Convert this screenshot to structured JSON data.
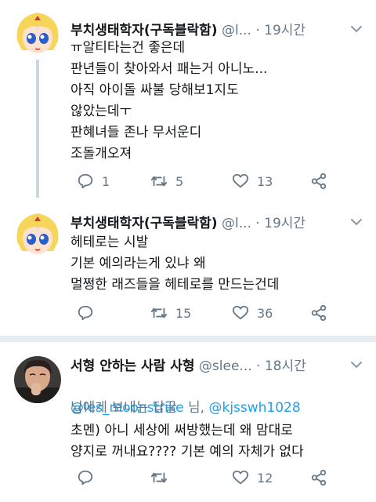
{
  "tweets": [
    {
      "name": "부치생태학자(구독블락함)",
      "handle": "@l...",
      "dot": "·",
      "time": "19시간",
      "text": "ㅠ알티타는건 좋은데\n판년들이 찾아와서 패는거 아니노...\n아직 아이돌 싸불 당해보1지도\n않았는데ㅜ\n판혜녀들 존나 무서운디\n조돌개오져",
      "replies": "1",
      "retweets": "5",
      "likes": "13"
    },
    {
      "name": "부치생태학자(구독블락함)",
      "handle": "@l...",
      "dot": "·",
      "time": "19시간",
      "text": "헤테로는 시발\n기본 예의라는게 있냐 왜\n멀쩡한 래즈들을 헤테로를 만드는건데",
      "replies": "",
      "retweets": "15",
      "likes": "36"
    },
    {
      "name": "서형 안하는 사람 사형",
      "handle": "@slee...",
      "dot": "·",
      "time": "18시간",
      "mention1": "@les_moonstrike",
      "mention_sep": " 님, ",
      "mention2": "@kjsswh1028",
      "reply_note": "님에게 보내는 답글",
      "text": "초멘) 아니 세상에 써방했는데 왜 맘대로\n양지로 꺼내요???? 기본 예의 자체가 없다",
      "replies": "",
      "retweets": "",
      "likes": "12"
    }
  ],
  "icons": {
    "reply": "reply-icon",
    "retweet": "retweet-icon",
    "like": "heart-icon",
    "share": "share-icon",
    "more": "chevron-down-icon"
  },
  "colors": {
    "text": "#14171a",
    "secondary": "#657786",
    "link": "#1da1f2",
    "divider": "#e1e8ed"
  }
}
